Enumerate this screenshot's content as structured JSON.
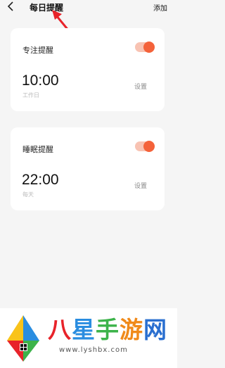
{
  "header": {
    "back_icon": "chevron-left-icon",
    "title": "每日提醒",
    "add_label": "添加"
  },
  "reminders": [
    {
      "label": "专注提醒",
      "time": "10:00",
      "repeat": "工作日",
      "settings_label": "设置",
      "enabled": true
    },
    {
      "label": "睡眠提醒",
      "time": "22:00",
      "repeat": "每天",
      "settings_label": "设置",
      "enabled": true
    }
  ],
  "colors": {
    "accent": "#f4623a",
    "toggle_track": "#f8c3b3",
    "background": "#f5f5f5",
    "annotation_arrow": "#e8232a"
  },
  "watermark": {
    "brand": "八星手游网",
    "url": "www.lyshbx.com"
  }
}
